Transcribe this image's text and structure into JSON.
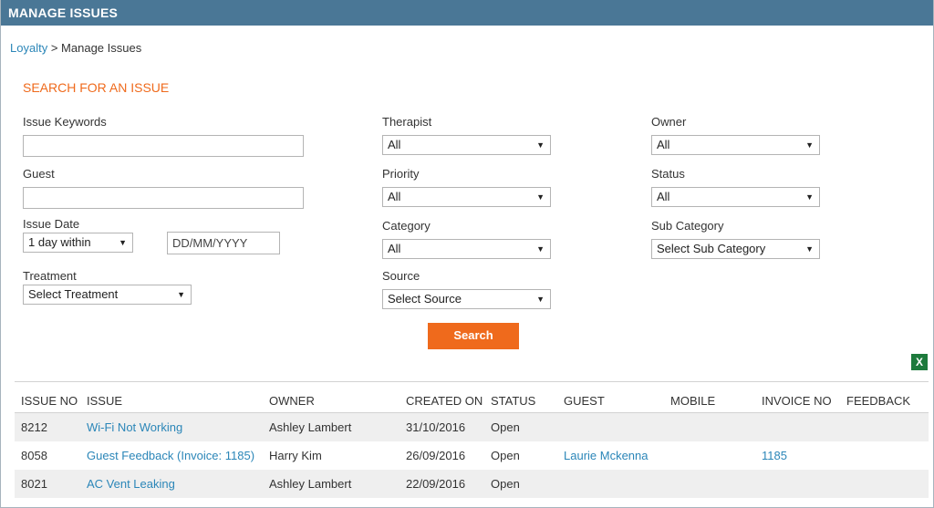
{
  "window": {
    "title": "MANAGE ISSUES"
  },
  "breadcrumb": {
    "root": "Loyalty",
    "separator": ">",
    "current": "Manage Issues"
  },
  "search": {
    "heading": "SEARCH FOR AN ISSUE",
    "issue_keywords": {
      "label": "Issue Keywords",
      "value": ""
    },
    "guest": {
      "label": "Guest",
      "value": ""
    },
    "issue_date": {
      "label": "Issue Date",
      "range": "1 day within",
      "date_placeholder": "DD/MM/YYYY"
    },
    "treatment": {
      "label": "Treatment",
      "value": "Select Treatment"
    },
    "therapist": {
      "label": "Therapist",
      "value": "All"
    },
    "priority": {
      "label": "Priority",
      "value": "All"
    },
    "category": {
      "label": "Category",
      "value": "All"
    },
    "source": {
      "label": "Source",
      "value": "Select Source"
    },
    "owner": {
      "label": "Owner",
      "value": "All"
    },
    "status": {
      "label": "Status",
      "value": "All"
    },
    "sub_category": {
      "label": "Sub Category",
      "value": "Select Sub Category"
    },
    "button_label": "Search"
  },
  "export": {
    "icon": "excel-icon",
    "glyph": "X"
  },
  "table": {
    "columns": [
      "ISSUE NO",
      "ISSUE",
      "OWNER",
      "CREATED ON",
      "STATUS",
      "GUEST",
      "MOBILE",
      "INVOICE NO",
      "FEEDBACK"
    ],
    "rows": [
      {
        "issue_no": "8212",
        "issue": "Wi-Fi Not Working",
        "owner": "Ashley Lambert",
        "created_on": "31/10/2016",
        "status": "Open",
        "guest": "",
        "mobile": "",
        "invoice_no": "",
        "feedback": ""
      },
      {
        "issue_no": "8058",
        "issue": "Guest Feedback (Invoice: 1185)",
        "owner": "Harry Kim",
        "created_on": "26/09/2016",
        "status": "Open",
        "guest": "Laurie Mckenna",
        "mobile": "",
        "invoice_no": "1185",
        "feedback": ""
      },
      {
        "issue_no": "8021",
        "issue": "AC Vent Leaking",
        "owner": "Ashley Lambert",
        "created_on": "22/09/2016",
        "status": "Open",
        "guest": "",
        "mobile": "",
        "invoice_no": "",
        "feedback": ""
      }
    ]
  },
  "colors": {
    "titlebar": "#4a7796",
    "accent": "#ef6a1c",
    "link": "#2b86b8",
    "excel": "#1d7a3c"
  }
}
